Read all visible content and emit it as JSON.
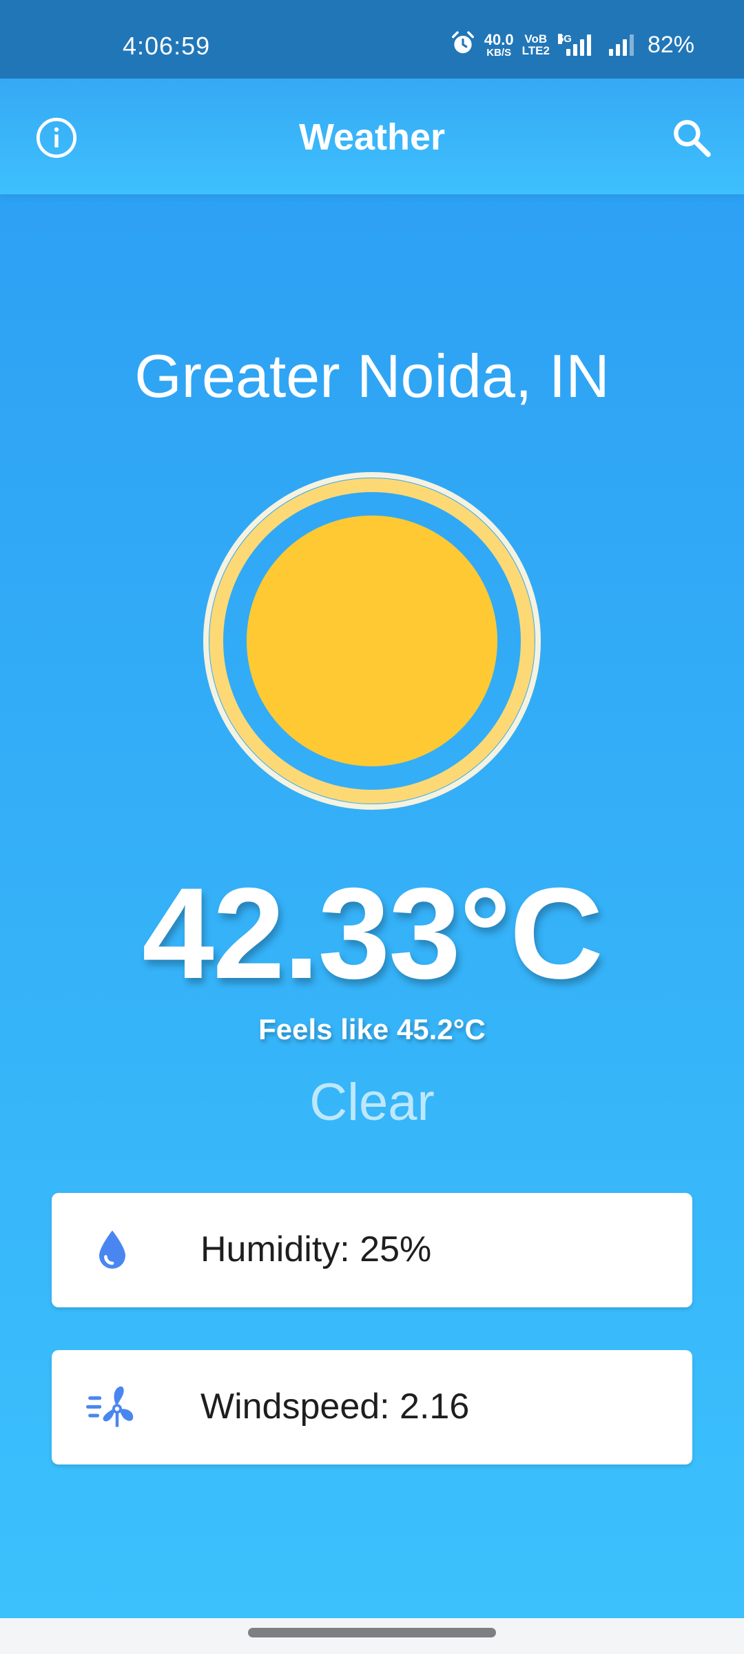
{
  "status_bar": {
    "time": "4:06:59",
    "net_speed": "40.0",
    "net_unit": "KB/S",
    "volte_top": "VoB",
    "volte_bottom": "LTE2",
    "network_type": "5G",
    "battery": "82%",
    "icons": [
      "alarm-icon",
      "signal-5g-icon",
      "signal-icon"
    ]
  },
  "app_bar": {
    "title": "Weather",
    "left_icon": "info-icon",
    "right_icon": "search-icon"
  },
  "weather": {
    "city": "Greater Noida, IN",
    "icon": "sun-icon",
    "temperature": "42.33°C",
    "feels_like": "Feels like 45.2°C",
    "condition": "Clear"
  },
  "details": [
    {
      "icon": "water-drop-icon",
      "label": "Humidity: 25%"
    },
    {
      "icon": "wind-fan-icon",
      "label": "Windspeed: 2.16"
    }
  ],
  "colors": {
    "status_bar": "#2176b8",
    "background_top": "#2b9cf2",
    "background_bottom": "#3cc2fd",
    "sun": "#ffc933",
    "sun_ring": "#fdd975",
    "icon_blue": "#4a86f0",
    "condition_text": "#bde8fb"
  }
}
